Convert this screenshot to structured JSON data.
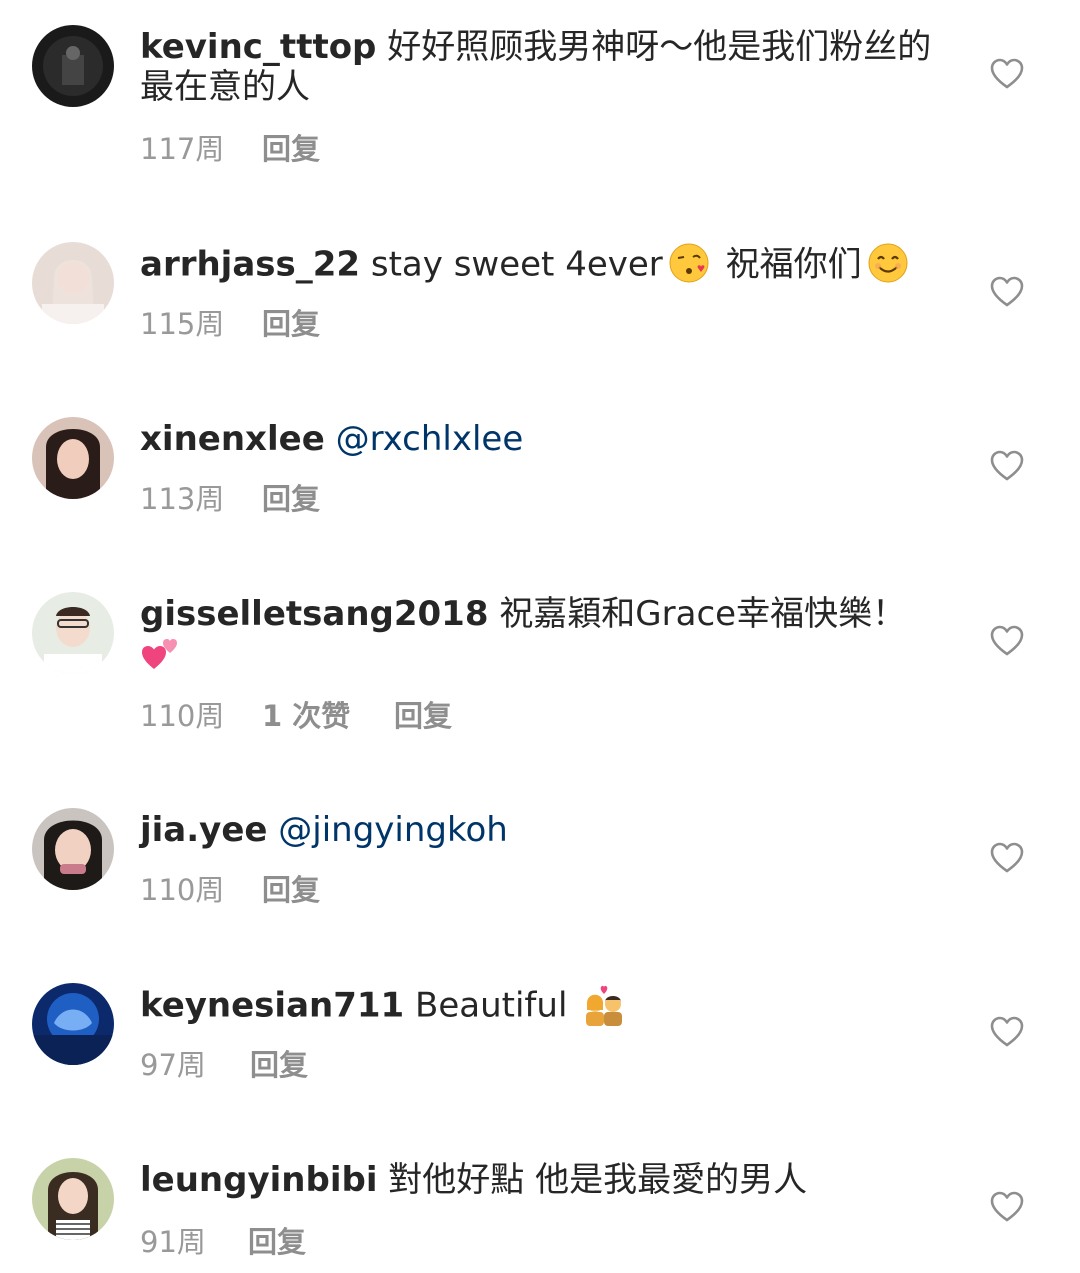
{
  "comments": [
    {
      "username": "kevinc_tttop",
      "text": "好好照顾我男神呀～他是我们粉丝的最在意的人",
      "time": "117周",
      "reply": "回复"
    },
    {
      "username": "arrhjass_22",
      "text_a": "stay sweet 4ever",
      "emoji_a": "kiss-face",
      "text_b": "祝福你们",
      "emoji_b": "smiling-face",
      "time": "115周",
      "reply": "回复"
    },
    {
      "username": "xinenxlee",
      "mention": "@rxchlxlee",
      "time": "113周",
      "reply": "回复"
    },
    {
      "username": "gisselletsang2018",
      "text": "祝嘉穎和Grace幸福快樂！",
      "emoji": "two-hearts",
      "time": "110周",
      "likes": "1 次赞",
      "reply": "回复"
    },
    {
      "username": "jia.yee",
      "mention": "@jingyingkoh",
      "time": "110周",
      "reply": "回复"
    },
    {
      "username": "keynesian711",
      "text": "Beautiful",
      "emoji": "couple-with-heart",
      "time": "97周",
      "reply": "回复"
    },
    {
      "username": "leungyinbibi",
      "text": "對他好點 他是我最愛的男人",
      "time": "91周",
      "reply": "回复"
    }
  ],
  "colors": {
    "text": "#262626",
    "meta": "#999999",
    "mention": "#003569",
    "heart_outline": "#8e8e8e"
  },
  "icons": {
    "like": "heart-outline-icon"
  }
}
